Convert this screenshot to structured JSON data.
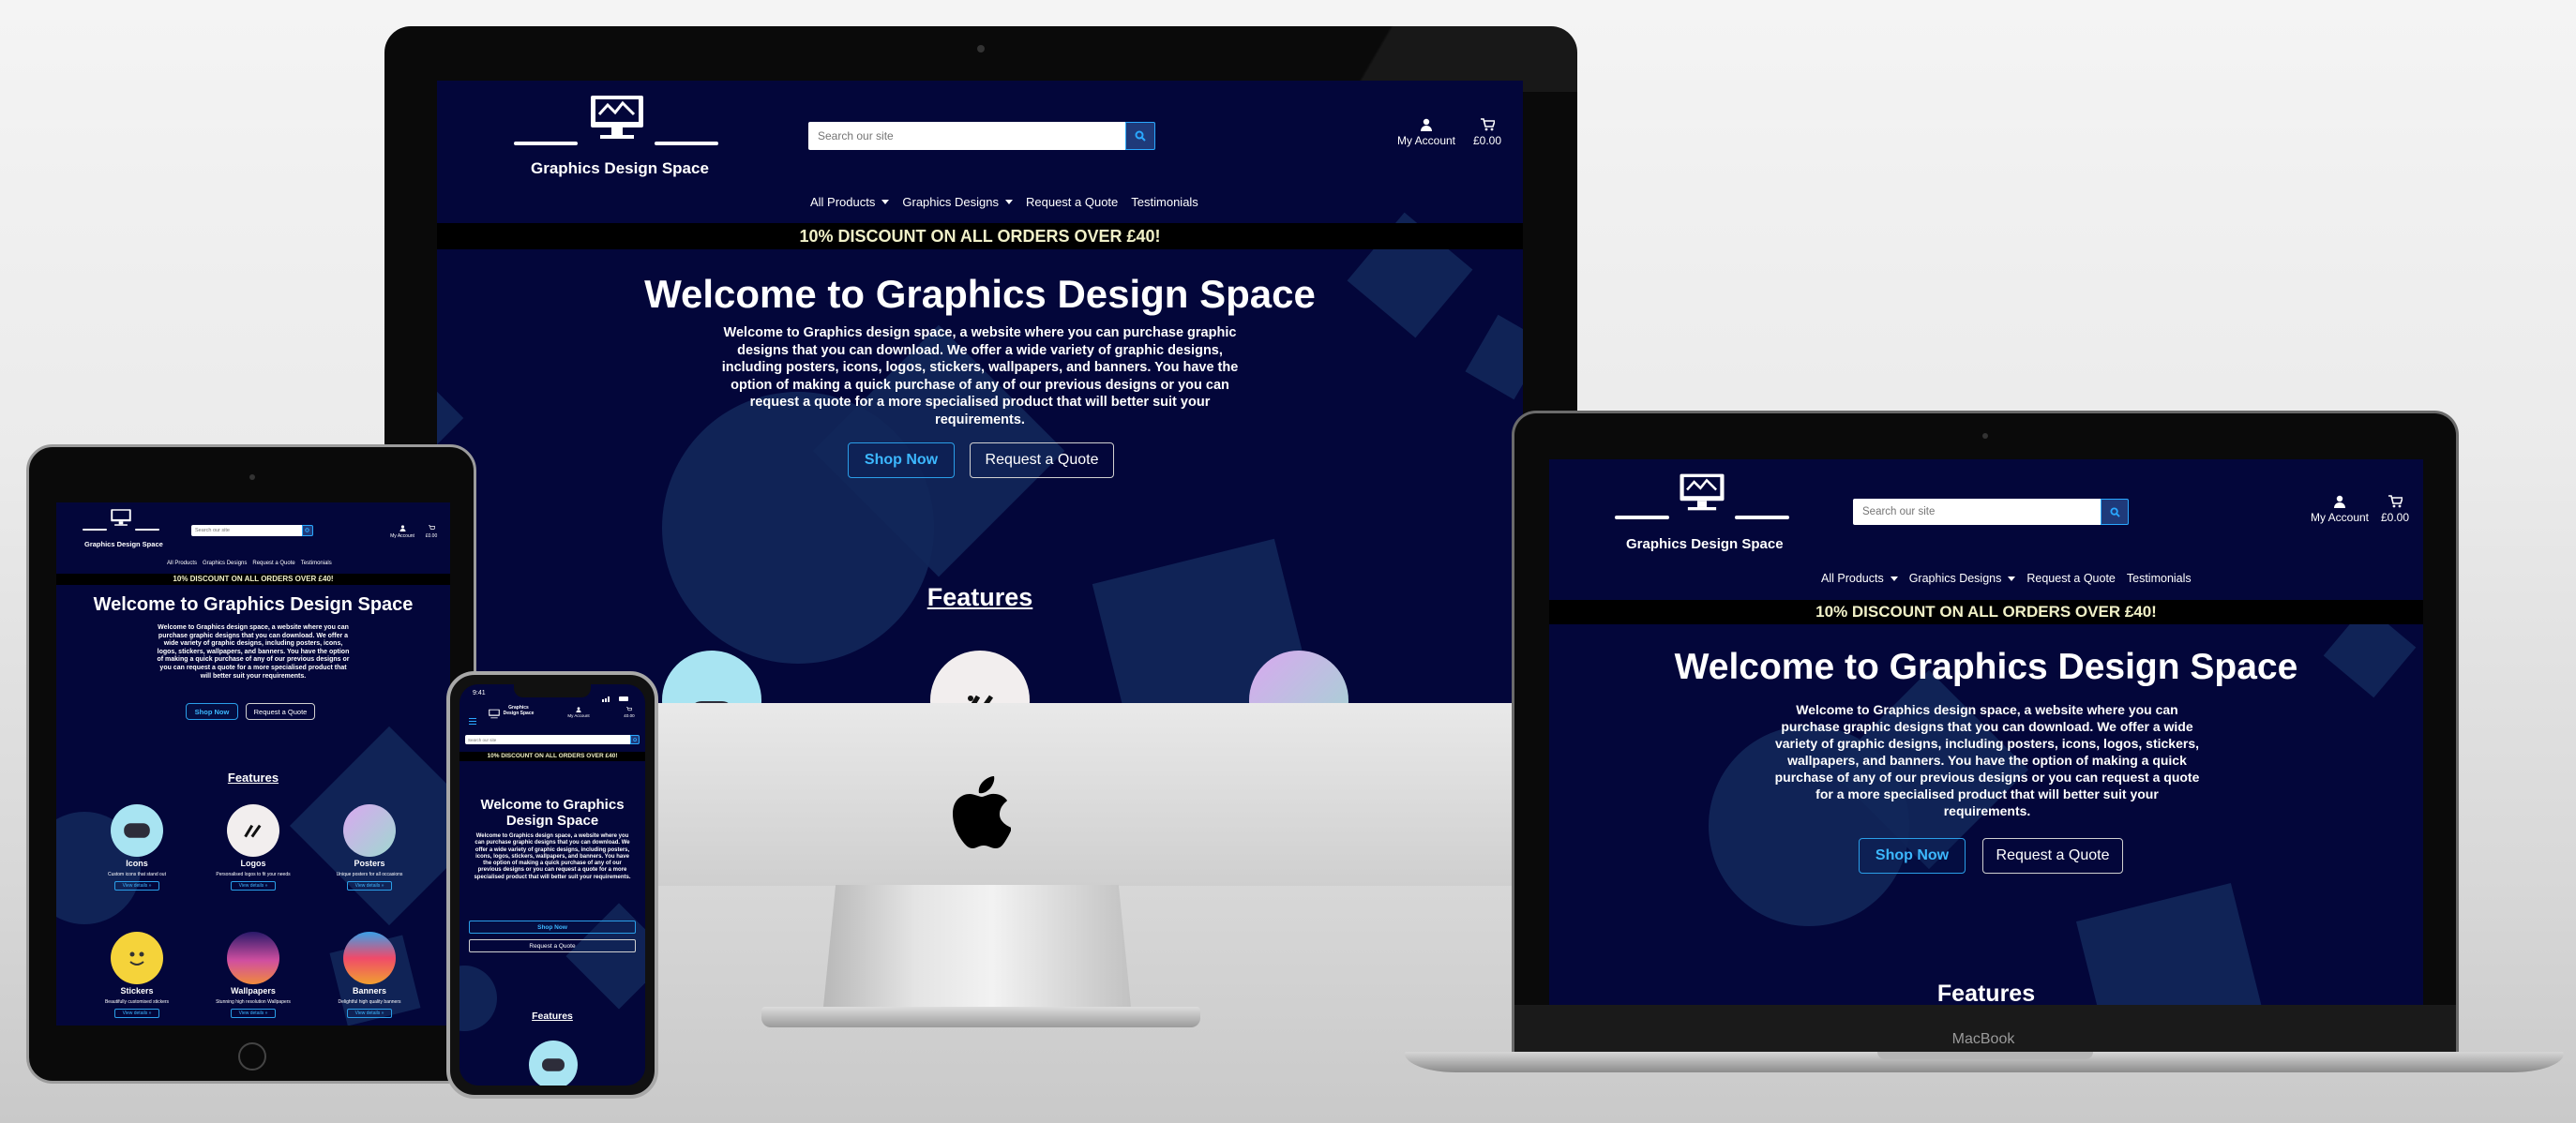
{
  "site": {
    "brand": "Graphics Design Space",
    "search_placeholder": "Search our site",
    "account_label": "My Account",
    "cart_total": "£0.00",
    "nav": [
      "All Products",
      "Graphics Designs",
      "Request a Quote",
      "Testimonials"
    ],
    "banner": "10% DISCOUNT ON ALL ORDERS OVER £40!",
    "hero_title": "Welcome to Graphics Design Space",
    "hero_text": "Welcome to Graphics design space, a website where you can purchase graphic designs that you can download. We offer a wide variety of graphic designs, including posters, icons, logos, stickers, wallpapers, and banners. You have the option of making a quick purchase of any of our previous designs or you can request a quote for a more specialised product that will better suit your requirements.",
    "shop_now": "Shop Now",
    "request_quote": "Request a Quote",
    "features_title": "Features",
    "features": [
      {
        "name": "Icons",
        "desc": "Custom icons that stand out",
        "link": "View details »"
      },
      {
        "name": "Logos",
        "desc": "Personalised logos to fit your needs",
        "link": "View details »"
      },
      {
        "name": "Posters",
        "desc": "Unique posters for all occasions",
        "link": "View details »"
      },
      {
        "name": "Stickers",
        "desc": "Beautifully customised stickers",
        "link": "View details »"
      },
      {
        "name": "Wallpapers",
        "desc": "Stunning high resolution Wallpapers",
        "link": "View details »"
      },
      {
        "name": "Banners",
        "desc": "Delightful high quality banners",
        "link": "View details »"
      }
    ]
  },
  "phone": {
    "time": "9:41"
  },
  "laptop": {
    "label": "MacBook"
  },
  "colors": {
    "site_bg": "#03063a",
    "accent": "#2aa8ff",
    "banner_text": "#f1f1c8"
  }
}
